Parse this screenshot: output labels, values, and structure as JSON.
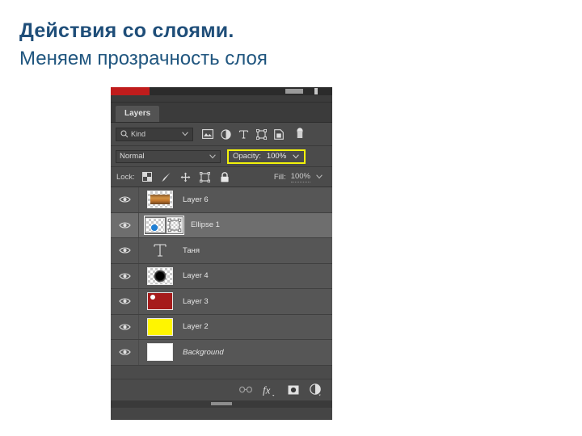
{
  "slide": {
    "title": "Действия со слоями.",
    "subtitle": "Меняем прозрачность слоя",
    "title_color": "#1f4e79"
  },
  "panel": {
    "tab_label": "Layers",
    "filter": {
      "kind_label": "Kind",
      "icons": [
        "search-icon",
        "chevron-down-icon",
        "pixel-layer-filter-icon",
        "adjustment-layer-filter-icon",
        "type-layer-filter-icon",
        "shape-layer-filter-icon",
        "smart-object-filter-icon",
        "filter-toggle-icon"
      ]
    },
    "blend": {
      "mode": "Normal",
      "opacity_label": "Opacity:",
      "opacity_value": "100%",
      "highlight_color": "#f2f20a"
    },
    "lock": {
      "label": "Lock:",
      "icons": [
        "lock-transparency-icon",
        "lock-image-icon",
        "lock-position-icon",
        "lock-artboard-icon",
        "lock-all-icon"
      ],
      "fill_label": "Fill:",
      "fill_value": "100%"
    },
    "layers": [
      {
        "name": "Layer 6",
        "thumb": "image-food",
        "visible": true,
        "selected": false,
        "italic": false
      },
      {
        "name": "Ellipse 1",
        "thumb": "shape-ellipse",
        "visible": true,
        "selected": true,
        "italic": false
      },
      {
        "name": "Таня",
        "thumb": "type-T",
        "visible": true,
        "selected": false,
        "italic": false
      },
      {
        "name": "Layer 4",
        "thumb": "black-blob",
        "visible": true,
        "selected": false,
        "italic": false
      },
      {
        "name": "Layer 3",
        "thumb": "red-fill",
        "visible": true,
        "selected": false,
        "italic": false
      },
      {
        "name": "Layer 2",
        "thumb": "yellow-fill",
        "visible": true,
        "selected": false,
        "italic": false
      },
      {
        "name": "Background",
        "thumb": "white-fill",
        "visible": true,
        "selected": false,
        "italic": true
      }
    ],
    "bottom_icons": [
      "link-layers-icon",
      "layer-style-fx-icon",
      "layer-mask-icon",
      "adjustment-layer-icon"
    ],
    "colors": {
      "panel_bg": "#454545",
      "layer_row_bg": "#565656",
      "layer_row_selected_bg": "#6e6e6e",
      "accent_red": "#c01c1c",
      "thumb_red": "#a61b1b",
      "thumb_yellow": "#fff500",
      "thumb_white": "#ffffff"
    }
  }
}
